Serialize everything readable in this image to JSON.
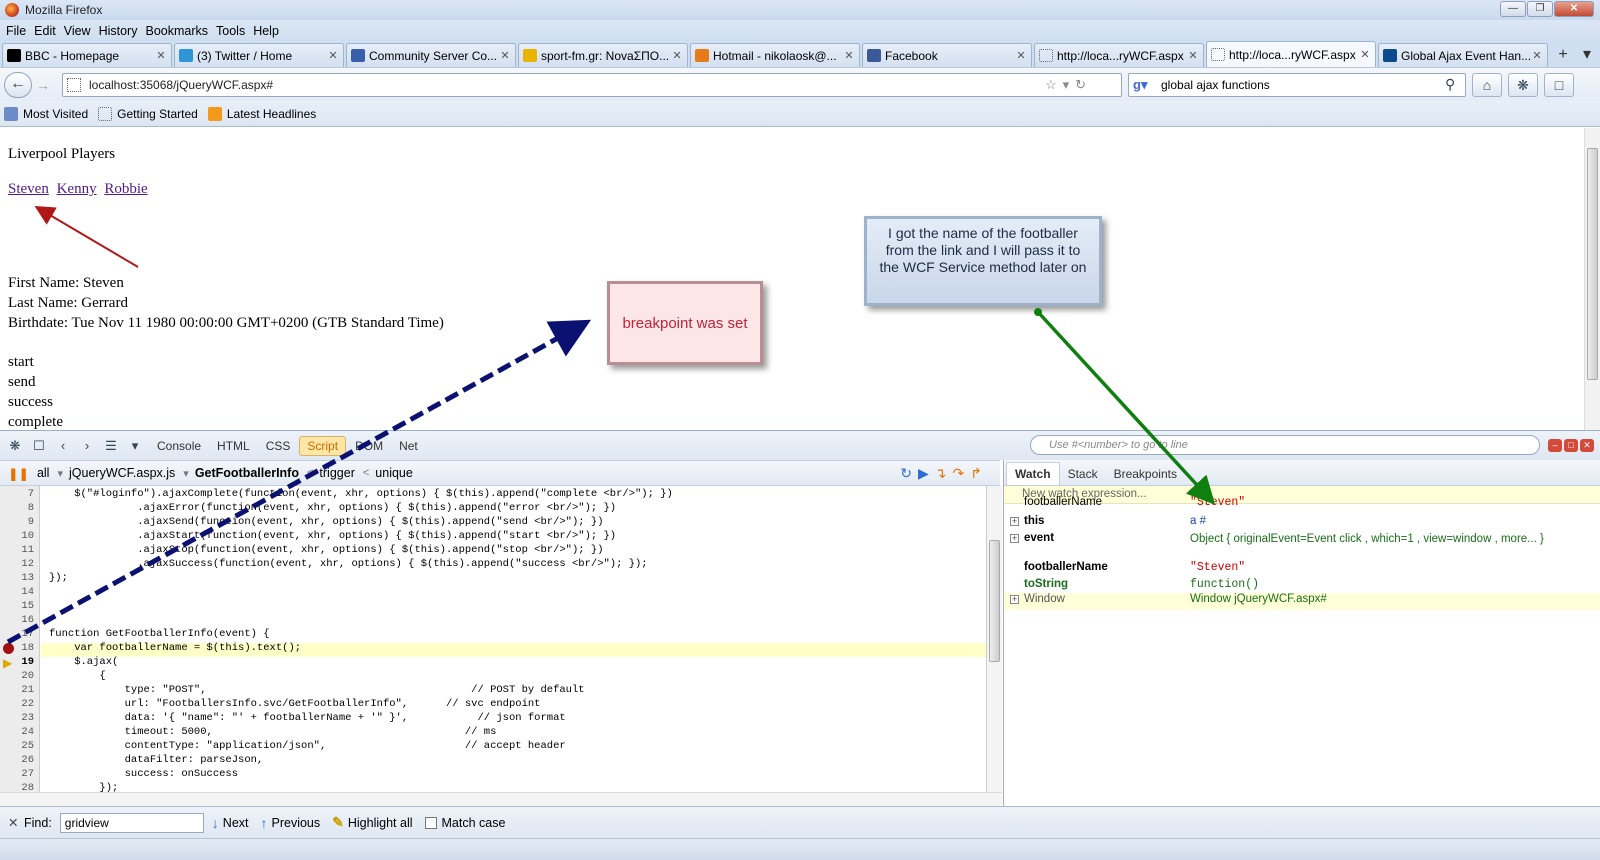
{
  "window": {
    "title": "Mozilla Firefox"
  },
  "menu": [
    "File",
    "Edit",
    "View",
    "History",
    "Bookmarks",
    "Tools",
    "Help"
  ],
  "tabs": [
    {
      "label": "BBC - Homepage",
      "color": "#000000"
    },
    {
      "label": "(3) Twitter / Home",
      "color": "#2f95d6"
    },
    {
      "label": "Community Server Co...",
      "color": "#3a5fa8"
    },
    {
      "label": "sport-fm.gr: NovaΣΠΟ...",
      "color": "#e8b400"
    },
    {
      "label": "Hotmail - nikolaosk@...",
      "color": "#e87a1c"
    },
    {
      "label": "Facebook",
      "color": "#3b5998"
    },
    {
      "label": "http://loca...ryWCF.aspx",
      "color": "#ffffff"
    },
    {
      "label": "http://loca...ryWCF.aspx",
      "color": "#ffffff"
    },
    {
      "label": "Global Ajax Event Han...",
      "color": "#0b4a8b"
    }
  ],
  "nav": {
    "url": "localhost:35068/jQueryWCF.aspx#",
    "search": "global ajax functions"
  },
  "bookmarks": [
    "Most Visited",
    "Getting Started",
    "Latest Headlines"
  ],
  "page": {
    "heading": "Liverpool Players",
    "players": [
      "Steven",
      "Kenny",
      "Robbie"
    ],
    "first_name": "First Name: Steven",
    "last_name": "Last Name: Gerrard",
    "birthdate": "Birthdate: Tue Nov 11 1980 00:00:00 GMT+0200 (GTB Standard Time)",
    "log": [
      "start",
      "send",
      "success",
      "complete"
    ]
  },
  "annotations": {
    "breakpoint": "breakpoint was set",
    "footballer": "I got the name of the footballer from the link and I will pass it to the WCF Service method later on"
  },
  "firebug": {
    "tabs": [
      "Console",
      "HTML",
      "CSS",
      "Script",
      "DOM",
      "Net"
    ],
    "active_tab": "Script",
    "search_placeholder": "Use #<number> to go to line",
    "script_filter": "all",
    "script_file": "jQueryWCF.aspx.js",
    "breadcrumb": [
      "GetFootballerInfo",
      "trigger",
      "unique"
    ],
    "code_lines": [
      {
        "n": "7",
        "text": "    $(\"#loginfo\").ajaxComplete(function(event, xhr, options) { $(this).append(\"complete <br/>\"); })"
      },
      {
        "n": "8",
        "text": "              .ajaxError(function(event, xhr, options) { $(this).append(\"error <br/>\"); })"
      },
      {
        "n": "9",
        "text": "              .ajaxSend(function(event, xhr, options) { $(this).append(\"send <br/>\"); })"
      },
      {
        "n": "10",
        "text": "              .ajaxStart(function(event, xhr, options) { $(this).append(\"start <br/>\"); })"
      },
      {
        "n": "11",
        "text": "              .ajaxStop(function(event, xhr, options) { $(this).append(\"stop <br/>\"); })"
      },
      {
        "n": "12",
        "text": "              .ajaxSuccess(function(event, xhr, options) { $(this).append(\"success <br/>\"); });"
      },
      {
        "n": "13",
        "text": "});"
      },
      {
        "n": "14",
        "text": ""
      },
      {
        "n": "15",
        "text": ""
      },
      {
        "n": "16",
        "text": ""
      },
      {
        "n": "17",
        "text": "function GetFootballerInfo(event) {"
      },
      {
        "n": "18",
        "text": "    var footballerName = $(this).text();"
      },
      {
        "n": "19",
        "text": "    $.ajax("
      },
      {
        "n": "20",
        "text": "        {"
      },
      {
        "n": "21",
        "text": "            type: \"POST\",                                          // POST by default"
      },
      {
        "n": "22",
        "text": "            url: \"FootballersInfo.svc/GetFootballerInfo\",      // svc endpoint"
      },
      {
        "n": "23",
        "text": "            data: '{ \"name\": \"' + footballerName + '\" }',           // json format"
      },
      {
        "n": "24",
        "text": "            timeout: 5000,                                        // ms"
      },
      {
        "n": "25",
        "text": "            contentType: \"application/json\",                      // accept header"
      },
      {
        "n": "26",
        "text": "            dataFilter: parseJson,"
      },
      {
        "n": "27",
        "text": "            success: onSuccess"
      },
      {
        "n": "28",
        "text": "        });"
      }
    ],
    "watch_tabs": [
      "Watch",
      "Stack",
      "Breakpoints"
    ],
    "watch_new": "New watch expression...",
    "watch_rows": [
      {
        "name": "footballerName",
        "value": "\"Steven\""
      },
      {
        "name": "this",
        "value": "a #"
      },
      {
        "name": "event",
        "value": "Object { originalEvent=Event click , which=1 , view=window , more... }"
      },
      {
        "name": "footballerName",
        "value": "\"Steven\""
      },
      {
        "name": "toString",
        "value": "function()"
      },
      {
        "name": "Window",
        "value": "Window jQueryWCF.aspx#"
      }
    ]
  },
  "findbar": {
    "label": "Find:",
    "query": "gridview",
    "next": "Next",
    "previous": "Previous",
    "highlight": "Highlight all",
    "match_case": "Match case"
  }
}
